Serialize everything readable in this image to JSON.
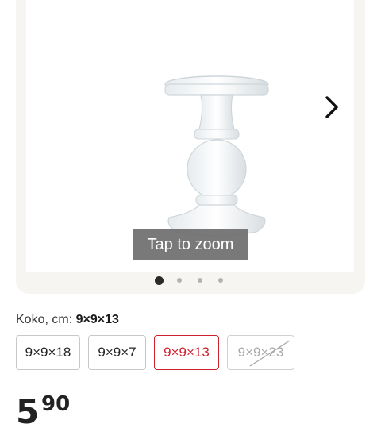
{
  "gallery": {
    "zoom_hint": "Tap to zoom",
    "next_icon": "chevron-right-icon",
    "dots": [
      {
        "active": true
      },
      {
        "active": false
      },
      {
        "active": false
      },
      {
        "active": false
      }
    ]
  },
  "variant": {
    "label": "Koko, cm:",
    "selected_value": "9×9×13",
    "options": [
      {
        "label": "9×9×18",
        "state": "available"
      },
      {
        "label": "9×9×7",
        "state": "available"
      },
      {
        "label": "9×9×13",
        "state": "selected"
      },
      {
        "label": "9×9×23",
        "state": "unavailable"
      }
    ]
  },
  "price": {
    "integer": "5",
    "decimals": "90"
  },
  "colors": {
    "accent": "#d0202e",
    "gallery_bg": "#f7f5f2"
  }
}
